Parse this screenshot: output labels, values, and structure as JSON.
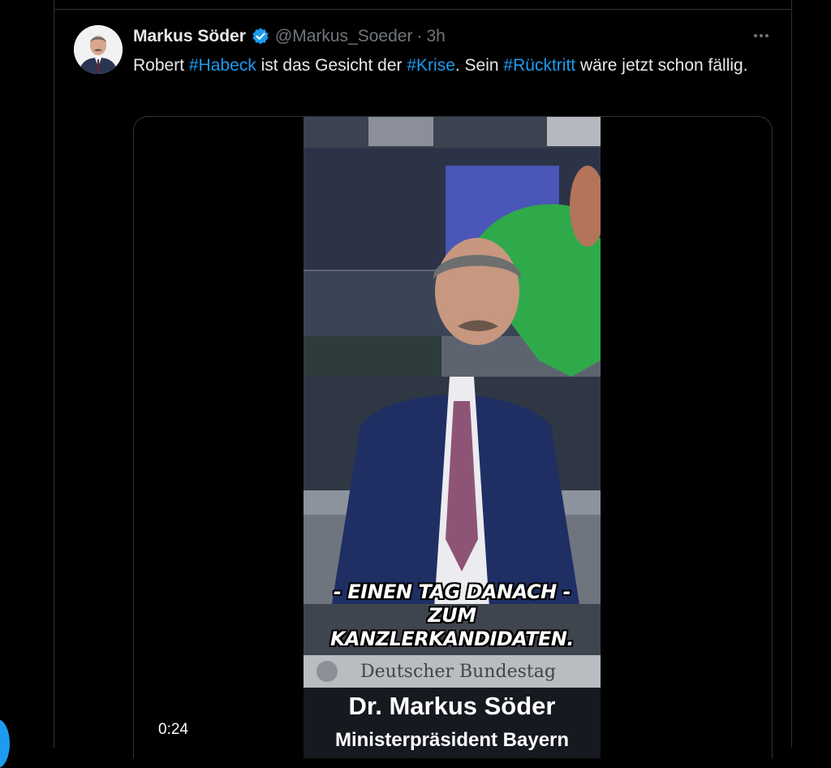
{
  "tweet": {
    "author_name": "Markus Söder",
    "handle": "@Markus_Soeder",
    "separator": "·",
    "time": "3h",
    "text_parts": {
      "p1": "Robert ",
      "tag1": "#Habeck",
      "p2": " ist das Gesicht der ",
      "tag2": "#Krise",
      "p3": ". Sein ",
      "tag3": "#Rücktritt",
      "p4": " wäre jetzt schon fällig."
    }
  },
  "video": {
    "duration": "0:24",
    "caption_line1": "- EINEN TAG DANACH -",
    "caption_line2": "ZUM",
    "caption_line3": "KANZLERKANDIDATEN.",
    "lower_third_org": "Deutscher Bundestag",
    "lower_third_name": "Dr. Markus Söder",
    "lower_third_role": "Ministerpräsident Bayern"
  },
  "icons": {
    "verified": "verified-badge-icon",
    "more": "more-options-icon"
  },
  "colors": {
    "background": "#000000",
    "text": "#e7e9ea",
    "muted": "#71767b",
    "link": "#1d9bf0",
    "border": "#2f3336"
  }
}
